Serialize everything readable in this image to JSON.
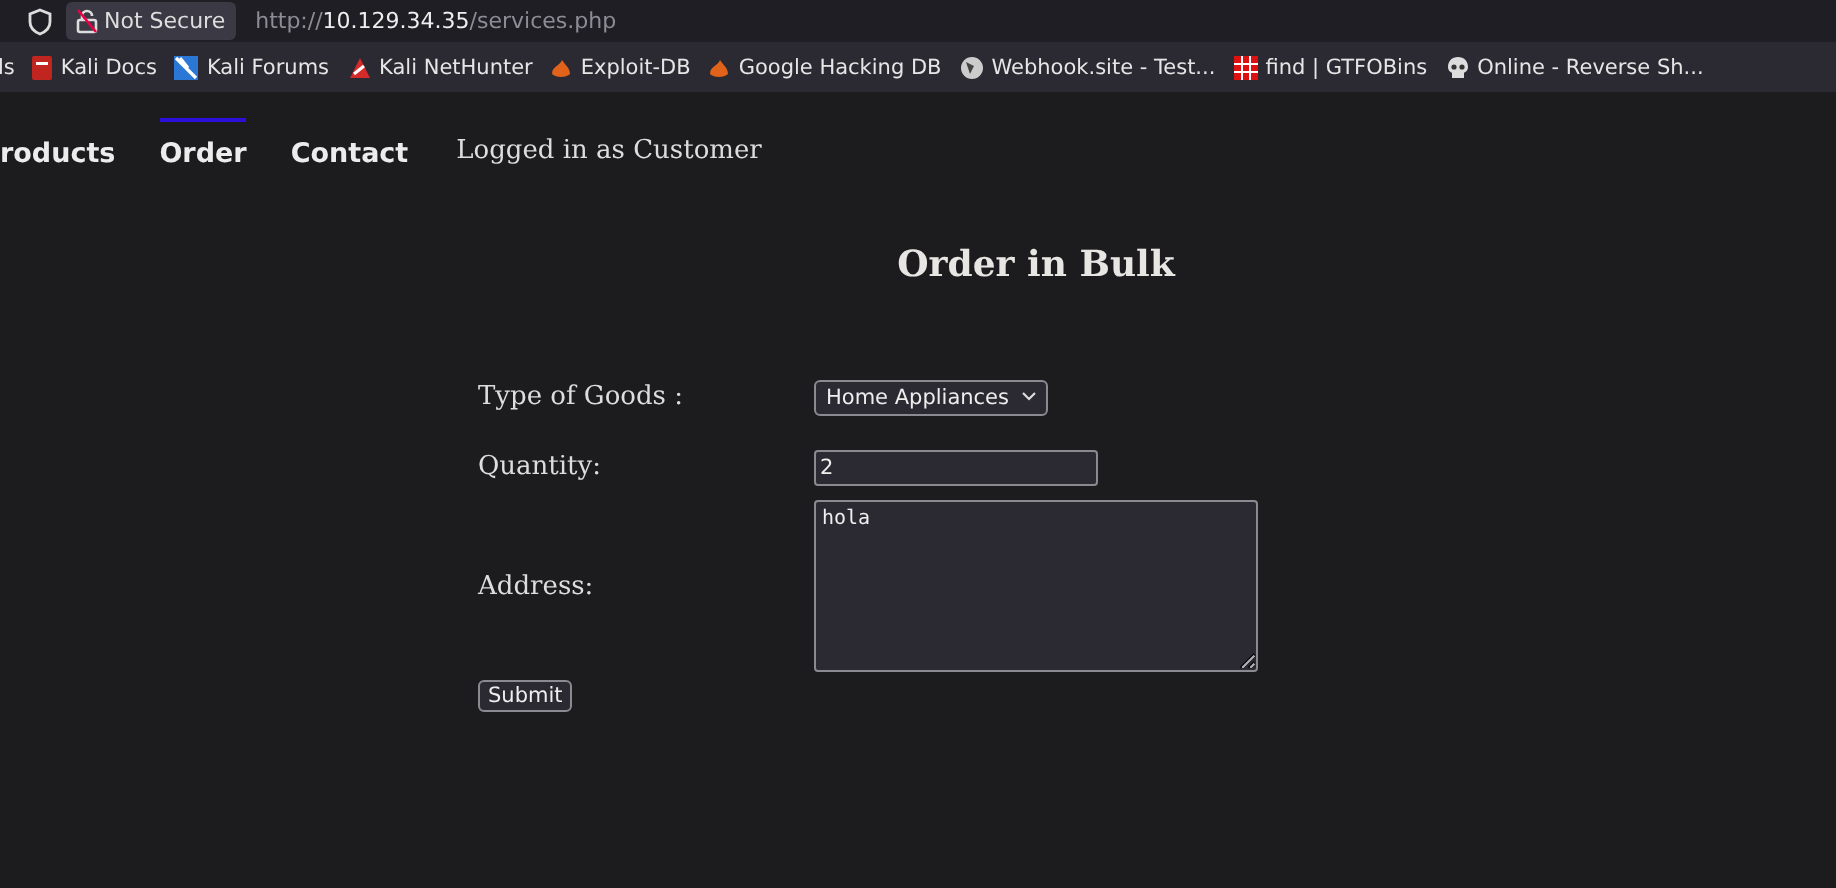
{
  "browser": {
    "security": "Not Secure",
    "url": {
      "scheme": "http://",
      "host": "10.129.34.35",
      "path": "/services.php"
    }
  },
  "bookmarks": [
    {
      "label": "ls"
    },
    {
      "label": "Kali Docs",
      "kind": "doc"
    },
    {
      "label": "Kali Forums",
      "kind": "forum"
    },
    {
      "label": "Kali NetHunter",
      "kind": "hunter"
    },
    {
      "label": "Exploit-DB",
      "kind": "flame"
    },
    {
      "label": "Google Hacking DB",
      "kind": "flame"
    },
    {
      "label": "Webhook.site - Test...",
      "kind": "globe"
    },
    {
      "label": "find | GTFOBins",
      "kind": "grid"
    },
    {
      "label": "Online - Reverse Sh...",
      "kind": "skull"
    }
  ],
  "nav": {
    "items": [
      {
        "label": "roducts",
        "selected": false
      },
      {
        "label": "Order",
        "selected": true
      },
      {
        "label": "Contact",
        "selected": false
      }
    ],
    "status": "Logged in as Customer"
  },
  "form": {
    "title": "Order in Bulk",
    "fields": [
      {
        "kind": "select",
        "label": "Type of Goods :",
        "value": "Home Appliances"
      },
      {
        "kind": "text",
        "label": "Quantity:",
        "value": "2"
      },
      {
        "kind": "textarea",
        "label": "Address:",
        "value": "hola"
      }
    ],
    "submit": "Submit"
  }
}
